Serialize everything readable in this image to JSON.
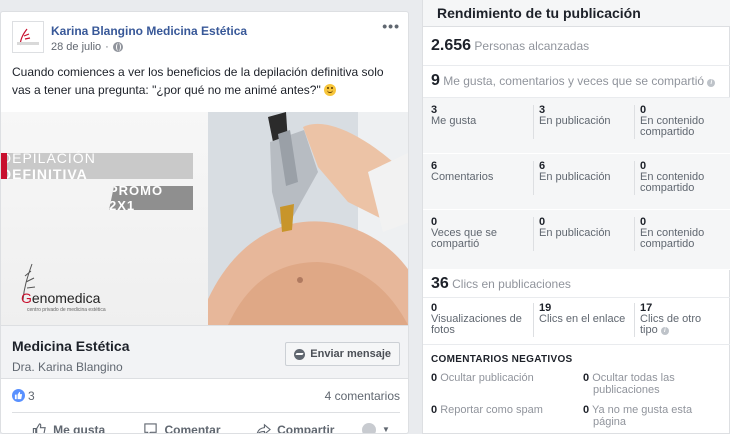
{
  "post": {
    "page_name": "Karina Blangino Medicina Estética",
    "date": "28 de julio",
    "date_sep": "·",
    "more": "•••",
    "text": "Cuando comiences a ver los beneficios de la depilación definitiva solo vas a tener una pregunta: \"¿por qué no me animé antes?\"",
    "image": {
      "banner_light": "DEPILACIÓN ",
      "banner_bold": "DEFINITIVA",
      "promo": "PROMO 2X1",
      "logo_g": "G",
      "logo_rest": "enomedica",
      "logo_sub": "centro privado de medicina estética"
    },
    "cta": {
      "title": "Medicina Estética",
      "subtitle": "Dra. Karina Blangino",
      "button": "Enviar mensaje"
    },
    "reactions": {
      "count": "3",
      "comments": "4 comentarios"
    },
    "actions": {
      "like": "Me gusta",
      "comment": "Comentar",
      "share": "Compartir"
    }
  },
  "insights": {
    "title": "Rendimiento de tu publicación",
    "reach": {
      "value": "2.656",
      "label": "Personas alcanzadas"
    },
    "engagement": {
      "value": "9",
      "label": "Me gusta, comentarios y veces que se compartió"
    },
    "rows": [
      {
        "a_n": "3",
        "a_l": "Me gusta",
        "b_n": "3",
        "b_l": "En publicación",
        "c_n": "0",
        "c_l1": "En contenido",
        "c_l2": "compartido"
      },
      {
        "a_n": "6",
        "a_l": "Comentarios",
        "b_n": "6",
        "b_l": "En publicación",
        "c_n": "0",
        "c_l1": "En contenido",
        "c_l2": "compartido"
      },
      {
        "a_n": "0",
        "a_l1": "Veces que se",
        "a_l2": "compartió",
        "b_n": "0",
        "b_l": "En publicación",
        "c_n": "0",
        "c_l1": "En contenido",
        "c_l2": "compartido"
      }
    ],
    "clicks": {
      "value": "36",
      "label": "Clics en publicaciones",
      "photos_n": "0",
      "photos_l1": "Visualizaciones de",
      "photos_l2": "fotos",
      "link_n": "19",
      "link_l": "Clics en el enlace",
      "other_n": "17",
      "other_l1": "Clics de otro",
      "other_l2": "tipo"
    },
    "negative": {
      "title": "COMENTARIOS NEGATIVOS",
      "hide_post_n": "0",
      "hide_post_l": "Ocultar publicación",
      "hide_all_n": "0",
      "hide_all_l1": "Ocultar todas las",
      "hide_all_l2": "publicaciones",
      "spam_n": "0",
      "spam_l": "Reportar como spam",
      "unlike_n": "0",
      "unlike_l1": "Ya no me gusta esta",
      "unlike_l2": "página"
    }
  },
  "colors": {
    "link": "#385898",
    "like_blue": "#5890ff",
    "brand_red": "#c8102e"
  }
}
